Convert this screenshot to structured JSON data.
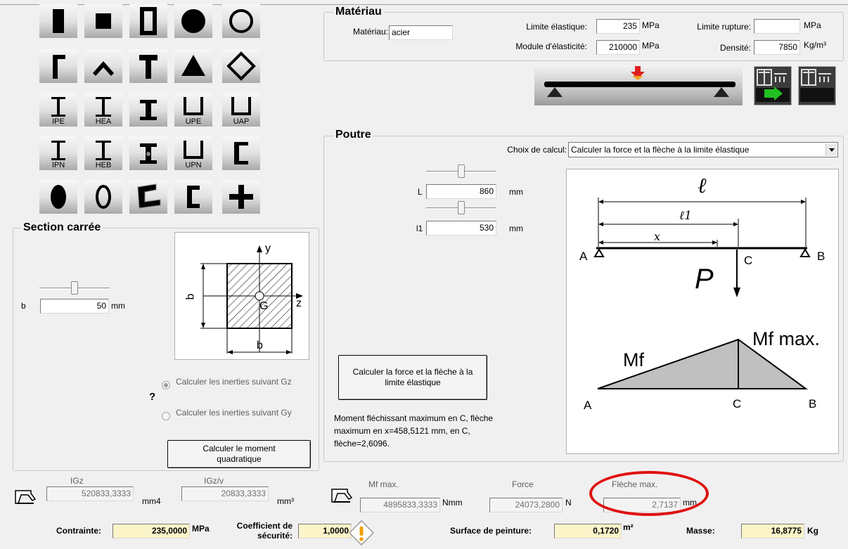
{
  "materiau": {
    "title": "Matériau",
    "materiau_label": "Matériau:",
    "materiau_value": "acier",
    "limite_elastique_label": "Limite élastique:",
    "limite_elastique_value": "235",
    "limite_elastique_unit": "MPa",
    "limite_rupture_label": "Limite rupture:",
    "limite_rupture_value": "",
    "limite_rupture_unit": "MPa",
    "module_label": "Module d'élasticité:",
    "module_value": "210000",
    "module_unit": "MPa",
    "densite_label": "Densité:",
    "densite_value": "7850",
    "densite_unit": "Kg/m³"
  },
  "section_buttons": [
    {
      "icon": "solid-rectangle-icon"
    },
    {
      "icon": "solid-square-icon"
    },
    {
      "icon": "hollow-rectangle-icon"
    },
    {
      "icon": "solid-circle-icon"
    },
    {
      "icon": "hollow-circle-icon"
    },
    {
      "icon": "angle-section-icon"
    },
    {
      "icon": "inverted-v-icon"
    },
    {
      "icon": "t-section-icon"
    },
    {
      "icon": "solid-triangle-icon"
    },
    {
      "icon": "hollow-diamond-icon"
    },
    {
      "icon": "ipe-beam-icon",
      "label": "IPE"
    },
    {
      "icon": "hea-beam-icon",
      "label": "HEA"
    },
    {
      "icon": "i-beam-icon"
    },
    {
      "icon": "upe-channel-icon",
      "label": "UPE"
    },
    {
      "icon": "uap-channel-icon",
      "label": "UAP"
    },
    {
      "icon": "ipn-beam-icon",
      "label": "IPN"
    },
    {
      "icon": "heb-beam-icon",
      "label": "HEB"
    },
    {
      "icon": "tapered-i-beam-icon"
    },
    {
      "icon": "upn-channel-icon",
      "label": "UPN"
    },
    {
      "icon": "c-channel-icon"
    },
    {
      "icon": "solid-ellipse-icon"
    },
    {
      "icon": "hollow-ellipse-icon"
    },
    {
      "icon": "z-profile-icon"
    },
    {
      "icon": "lipped-channel-icon"
    },
    {
      "icon": "cross-section-icon"
    }
  ],
  "section": {
    "title": "Section carrée",
    "b_label": "b",
    "b_value": "50",
    "b_unit": "mm",
    "slider_b": 0.5,
    "help": "?",
    "radio_gz": "Calculer les inerties suivant Gz",
    "radio_gy": "Calculer les inerties suivant Gy",
    "radio_selected": "gz",
    "calc_button": "Calculer le moment quadratique",
    "diagram": {
      "y": "y",
      "z": "z",
      "G": "G",
      "b_side": "b",
      "b_bottom": "b"
    }
  },
  "poutre": {
    "title": "Poutre",
    "choix_label": "Choix de calcul:",
    "choix_value": "Calculer la force et la flèche à la limite élastique",
    "L_label": "L",
    "L_value": "860",
    "L_unit": "mm",
    "slider_L": 0.5,
    "l1_label": "l1",
    "l1_value": "530",
    "l1_unit": "mm",
    "slider_l1": 0.5,
    "calc_button": "Calculer la force et la flèche à la limite élastique",
    "result_text": "Moment fléchissant maximum en C, flèche maximum en x=458,5121 mm, en C, flèche=2,6096.",
    "diagram": {
      "l": "ℓ",
      "l1": "ℓ1",
      "x": "x",
      "A": "A",
      "B": "B",
      "C": "C",
      "P": "P",
      "Mf": "Mf",
      "Mfmax": "Mf max.",
      "A2": "A",
      "C2": "C",
      "B2": "B"
    }
  },
  "results": {
    "igz_label": "IGz",
    "igz_value": "520833,3333",
    "igz_unit": "mm4",
    "igzv_label": "IGz/v",
    "igzv_value": "20833,3333",
    "igzv_unit": "mm³",
    "mfmax_label": "Mf max.",
    "mfmax_value": "4895833,3333",
    "mfmax_unit": "Nmm",
    "force_label": "Force",
    "force_value": "24073,2800",
    "force_unit": "N",
    "fleche_label": "Flèche max.",
    "fleche_value": "2,7137",
    "fleche_unit": "mm",
    "contrainte_label": "Contrainte:",
    "contrainte_value": "235,0000",
    "contrainte_unit": "MPa",
    "coef_label": "Coefficient de sécurité:",
    "coef_value": "1,0000",
    "surface_label": "Surface de peinture:",
    "surface_value": "0,1720",
    "surface_unit": "m²",
    "masse_label": "Masse:",
    "masse_value": "16,8775",
    "masse_unit": "Kg"
  },
  "colors": {
    "highlight_ellipse": "#e01010",
    "arrow_red": "#e02020",
    "arrow_green": "#20c020"
  }
}
